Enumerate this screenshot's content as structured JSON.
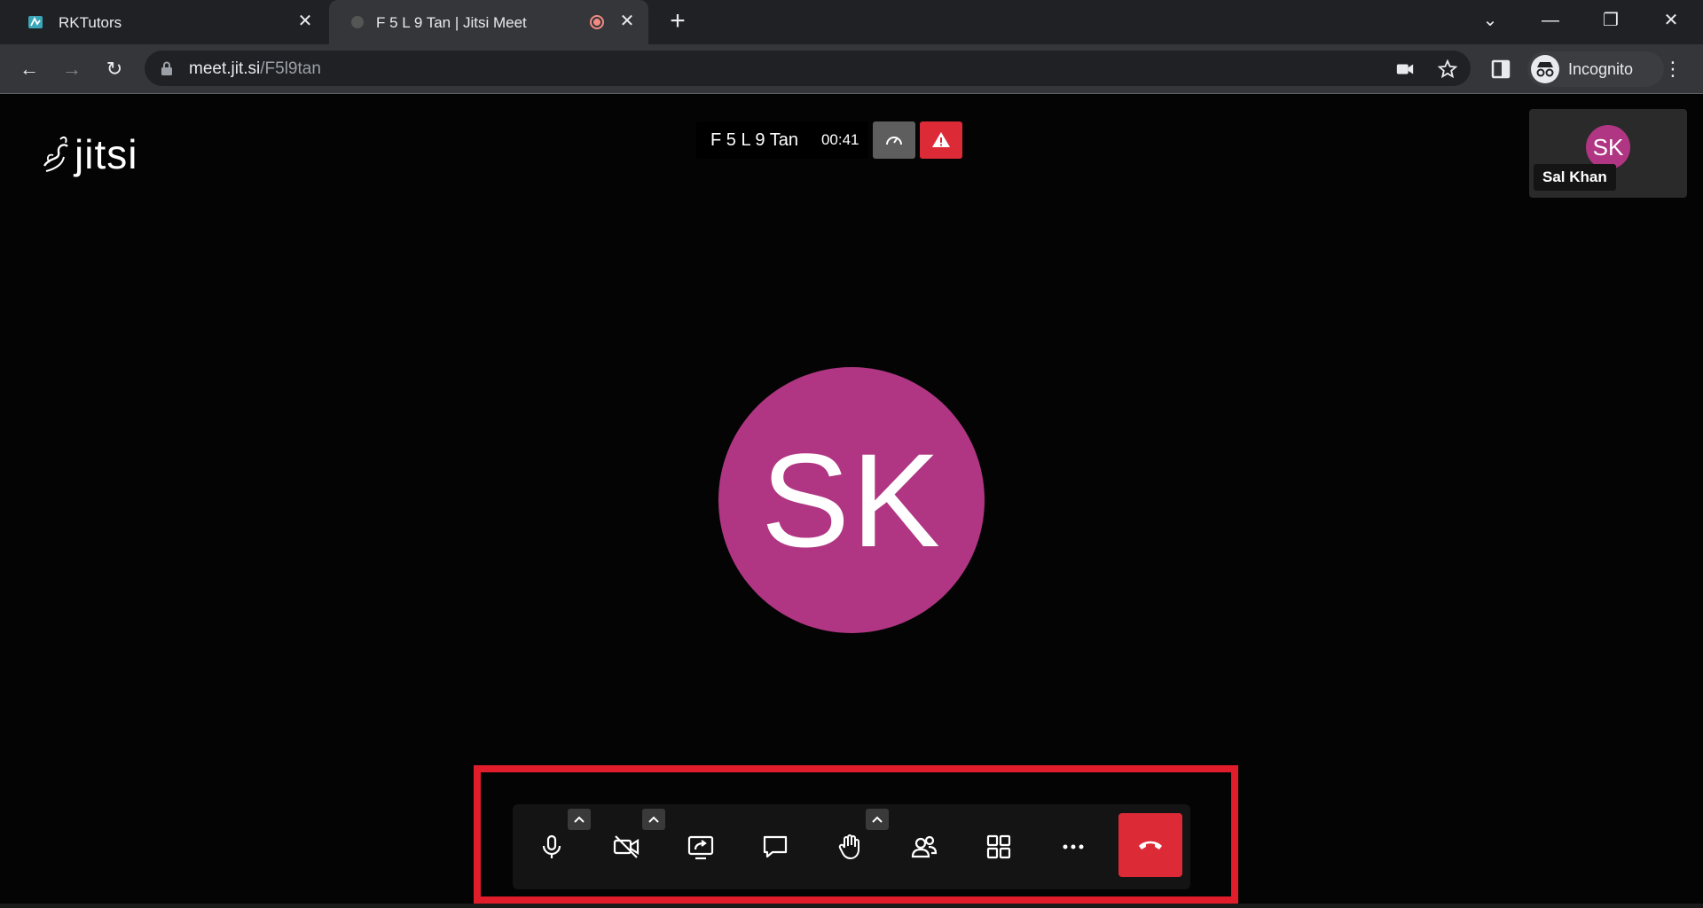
{
  "browser": {
    "tabs": [
      {
        "title": "RKTutors",
        "favicon": "rktutors-favicon",
        "active": false
      },
      {
        "title": "F 5 L 9 Tan | Jitsi Meet",
        "favicon": "jitsi-favicon",
        "active": true,
        "recording": true
      }
    ],
    "url": {
      "host": "meet.jit.si",
      "path": "/F5l9tan"
    },
    "profile": "Incognito"
  },
  "meeting": {
    "logo_text": "jitsi",
    "subject": "F 5 L 9 Tan",
    "timer": "00:41",
    "participant": {
      "initials": "SK",
      "name": "Sal Khan",
      "avatar_color": "#b03683"
    },
    "large_initials": "SK"
  },
  "toolbar": {
    "buttons": [
      "microphone",
      "camera-off",
      "share-screen",
      "chat",
      "raise-hand",
      "participants",
      "tile-view",
      "more-actions",
      "hang-up"
    ]
  },
  "colors": {
    "accent_red": "#dc2b37",
    "highlight": "#e11d2b",
    "avatar": "#b03683"
  }
}
